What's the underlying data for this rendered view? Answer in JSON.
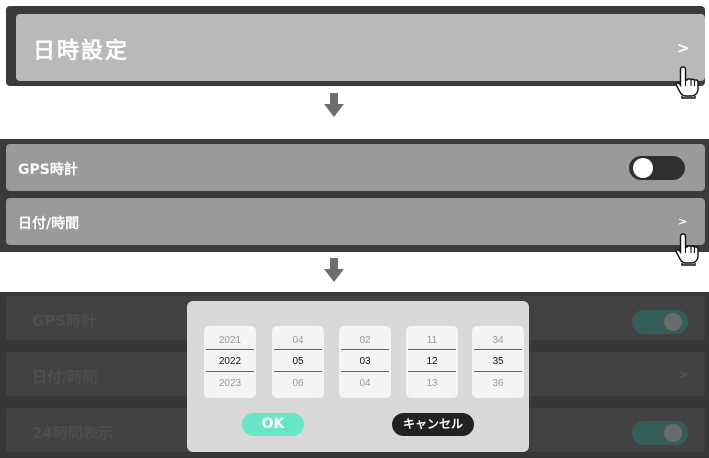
{
  "step1": {
    "title": "日時設定",
    "chevron": ">"
  },
  "step2": {
    "gps_label": "GPS時計",
    "gps_toggle": "off",
    "datetime_label": "日付/時間",
    "chevron": ">"
  },
  "step3": {
    "gps_label": "GPS時計",
    "datetime_label": "日付/時間",
    "format_label": "24時間表示",
    "chevron": ">",
    "accent_color": "#1a8a6e"
  },
  "dialog": {
    "columns": [
      {
        "prev": "2021",
        "current": "2022",
        "next": "2023"
      },
      {
        "prev": "04",
        "current": "05",
        "next": "06"
      },
      {
        "prev": "02",
        "current": "03",
        "next": "04"
      },
      {
        "prev": "11",
        "current": "12",
        "next": "13"
      },
      {
        "prev": "34",
        "current": "35",
        "next": "36"
      }
    ],
    "ok_label": "OK",
    "cancel_label": "キャンセル",
    "ok_color": "#66e6c7"
  },
  "icons": {
    "arrow": "down-arrow-icon",
    "pointer": "hand-pointer-icon"
  }
}
